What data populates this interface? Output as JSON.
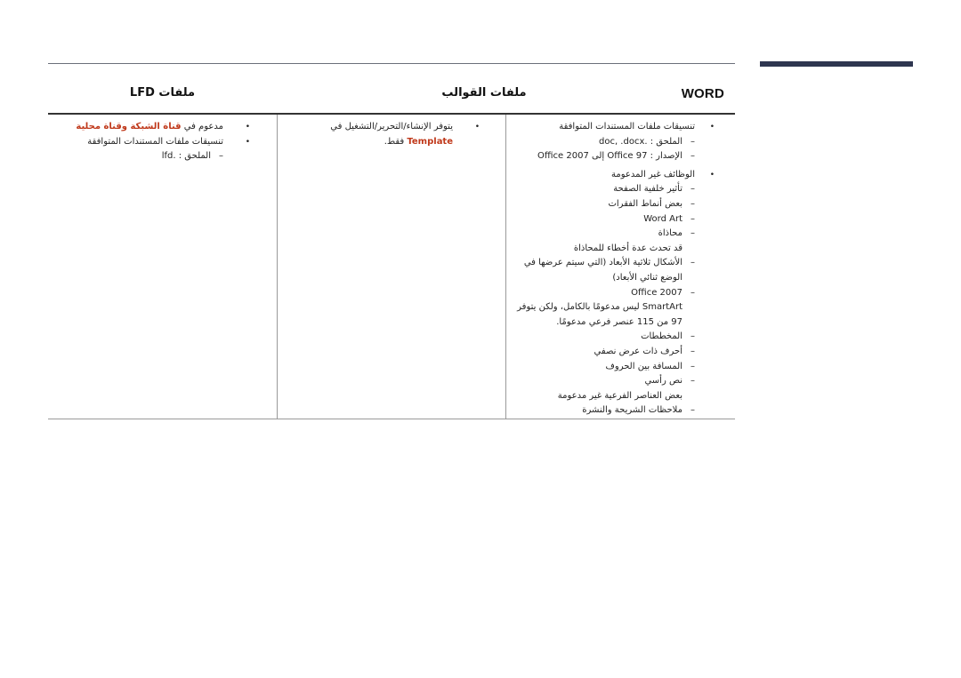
{
  "accent_colors": {
    "highlight_red": "#c0391b",
    "side_bar": "#2e3650"
  },
  "table": {
    "headers": {
      "word": "WORD",
      "templates": "ملفات القوالب",
      "lfd": "ملفات LFD"
    },
    "word_column": {
      "items": [
        {
          "type": "bullet",
          "text": "تنسيقات ملفات المستندات المتوافقة"
        },
        {
          "type": "dash",
          "text": "الملحق : .doc, .docx"
        },
        {
          "type": "dash",
          "text": "الإصدار : Office 97 إلى Office 2007"
        },
        {
          "type": "bullet",
          "text": "الوظائف غير المدعومة"
        },
        {
          "type": "dash",
          "text": "تأثير خلفية الصفحة"
        },
        {
          "type": "dash",
          "text": "بعض أنماط الفقرات"
        },
        {
          "type": "dash",
          "text": "Word Art"
        },
        {
          "type": "dash",
          "text": "محاذاة"
        },
        {
          "type": "note",
          "text": "قد تحدث عدة أخطاء للمحاذاة"
        },
        {
          "type": "dash",
          "text": "الأشكال ثلاثية الأبعاد (التي سيتم عرضها في الوضع ثنائي الأبعاد)"
        },
        {
          "type": "dash",
          "text": "Office 2007"
        },
        {
          "type": "note",
          "text": "SmartArt ليس مدعومًا بالكامل، ولكن يتوفر 97 من 115 عنصر فرعي مدعومًا."
        },
        {
          "type": "dash",
          "text": "المخططات"
        },
        {
          "type": "dash",
          "text": "أحرف ذات عرض نصفي"
        },
        {
          "type": "dash",
          "text": "المسافة بين الحروف"
        },
        {
          "type": "dash",
          "text": "نص رأسي"
        },
        {
          "type": "note",
          "text": "بعض العناصر الفرعية غير مدعومة"
        },
        {
          "type": "dash",
          "text": "ملاحظات الشريحة والنشرة"
        }
      ]
    },
    "templates_column": {
      "bullet_prefix": "يتوفر الإنشاء/التحرير/التشغيل في",
      "bullet_highlight": "Template",
      "bullet_suffix": "فقط."
    },
    "lfd_column": {
      "supported_prefix": "مدعوم في",
      "supported_highlight": "قناة الشبكة وقناة محلية",
      "formats_label": "تنسيقات ملفات المستندات المتوافقة",
      "extension": "الملحق : .lfd"
    }
  }
}
